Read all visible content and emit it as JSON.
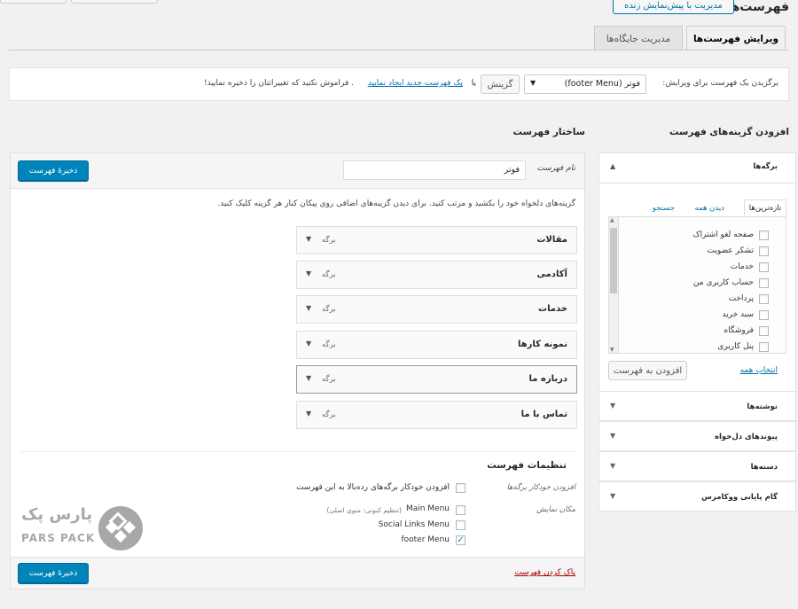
{
  "header": {
    "title": "فهرست‌ها",
    "live_preview_button": "مدیریت با پیش‌نمایش زنده"
  },
  "tabs": [
    {
      "label": "ویرایش فهرست‌ها"
    },
    {
      "label": "مدیریت جایگاه‌ها"
    }
  ],
  "select_bar": {
    "prompt": "برگزیدن یک فهرست برای ویرایش:",
    "selected_menu": "فوتر (footer Menu)",
    "select_button": "گزینش",
    "or_text": "یا",
    "create_link": "یک فهرست جدید ایجاد نمایید",
    "warning": ". فراموش نکنید که تغییراتتان را ذخیره نمایید!"
  },
  "left_panel": {
    "heading": "افزودن گزینه‌های فهرست",
    "pages_section": {
      "label": "برگه‌ها",
      "tabs": [
        "تازه‌ترین‌ها",
        "دیدن همه",
        "جستجو"
      ],
      "items": [
        "صفحه لغو اشتراک",
        "تشکر عضویت",
        "خدمات",
        "حساب کاربری من",
        "پرداخت",
        "سبد خرید",
        "فروشگاه",
        "پنل کاربری"
      ],
      "select_all": "انتخاب همه",
      "add_button": "افزودن به فهرست"
    },
    "other_sections": [
      "نوشته‌ها",
      "پیوندهای دل‌خواه",
      "دسته‌ها",
      "گام پایانی ووکامرس"
    ]
  },
  "structure": {
    "heading": "ساختار فهرست",
    "name_label": "نام فهرست",
    "name_value": "فوتر",
    "save_button": "ذخیرهٔ فهرست",
    "instructions": "گزینه‌های دلخواه خود را بکشید و مرتب کنید. برای دیدن گزینه‌های اضافی روی پیکان کنار هر گزینه کلیک کنید.",
    "items": [
      {
        "title": "مقالات",
        "type": "برگه"
      },
      {
        "title": "آکادمی",
        "type": "برگه"
      },
      {
        "title": "خدمات",
        "type": "برگه"
      },
      {
        "title": "نمونه کارها",
        "type": "برگه"
      },
      {
        "title": "درباره ما",
        "type": "برگه"
      },
      {
        "title": "تماس با ما",
        "type": "برگه"
      }
    ],
    "settings": {
      "heading": "تنظیمات فهرست",
      "auto_add_label": "افزودن خودکار برگه‌ها",
      "auto_add_option": "افزودن خودکار برگه‌های رده‌بالا به این فهرست",
      "location_label": "مکان نمایش",
      "locations": [
        {
          "name": "Main Menu",
          "note": "(تنظیم کنونی: منوی اصلی)",
          "checked": false
        },
        {
          "name": "Social Links Menu",
          "note": "",
          "checked": false
        },
        {
          "name": "footer Menu",
          "note": "",
          "checked": true
        }
      ]
    },
    "delete_link": "پاک کردن فهرست"
  },
  "watermark": {
    "brand_fa": "پارس پک",
    "brand_en": "PARS PACK"
  },
  "colors": {
    "primary": "#0085ba",
    "link": "#0073aa",
    "delete": "#a00"
  }
}
